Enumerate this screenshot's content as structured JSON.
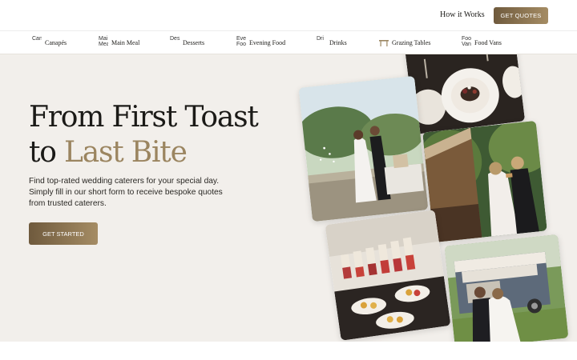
{
  "header": {
    "nav_link": "How it Works",
    "cta_label": "GET QUOTES"
  },
  "categories": [
    {
      "label": "Canapés",
      "alt": "Can"
    },
    {
      "label": "Main Meal",
      "alt": "Mai Mea"
    },
    {
      "label": "Desserts",
      "alt": "Des"
    },
    {
      "label": "Evening Food",
      "alt": "Eve Foo"
    },
    {
      "label": "Drinks",
      "alt": "Dri"
    },
    {
      "label": "Grazing Tables",
      "alt": ""
    },
    {
      "label": "Food Vans",
      "alt": "Foo Van"
    }
  ],
  "hero": {
    "title_line1": "From First Toast",
    "title_line2_plain": "to ",
    "title_line2_accent": "Last Bite",
    "subtitle": "Find top-rated wedding caterers for your special day. Simply fill in our short form to receive bespoke quotes from trusted caterers.",
    "cta_label": "GET STARTED"
  },
  "colors": {
    "accent": "#9b8560",
    "button_gradient_start": "#6f5a3d",
    "button_gradient_end": "#a58c64",
    "hero_bg": "#f2efeb"
  }
}
